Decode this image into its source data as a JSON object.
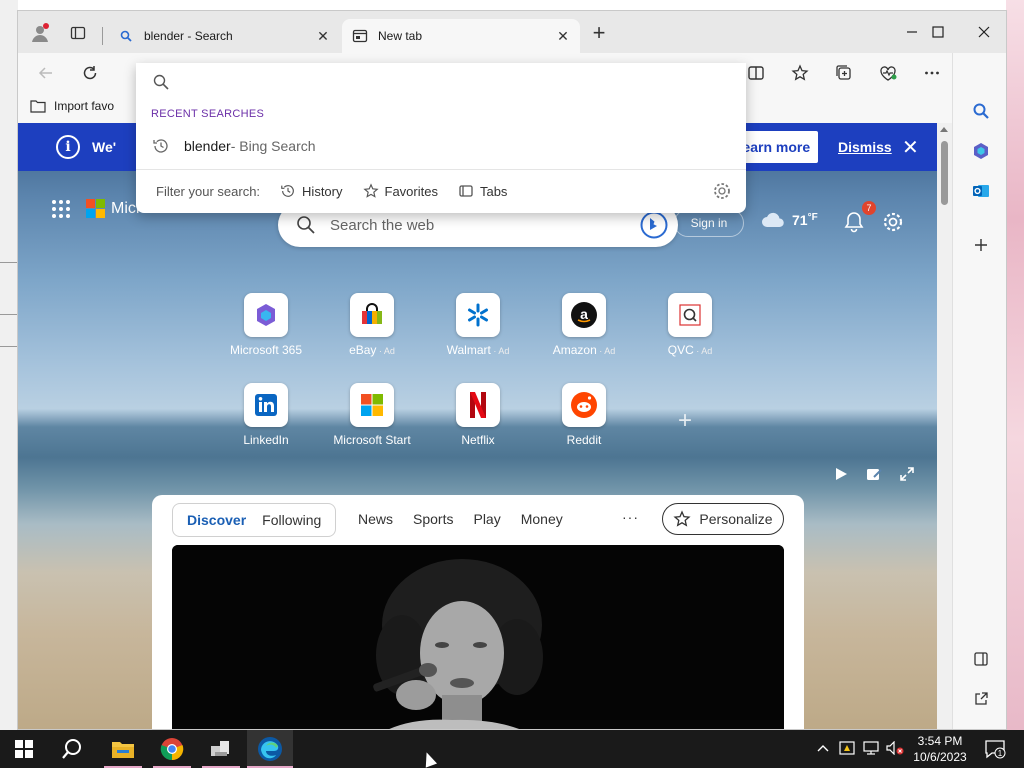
{
  "tabs": [
    {
      "title": "blender - Search",
      "active": false
    },
    {
      "title": "New tab",
      "active": true
    }
  ],
  "favorites_bar": {
    "import_label": "Import favo"
  },
  "address_dropdown": {
    "recent_header": "RECENT SEARCHES",
    "recent_items": [
      {
        "query": "blender",
        "suffix": " - Bing Search"
      }
    ],
    "filter_label": "Filter your search:",
    "filters": [
      "History",
      "Favorites",
      "Tabs"
    ]
  },
  "banner": {
    "message": "We'",
    "learn_more": "Learn more",
    "dismiss": "Dismiss"
  },
  "header": {
    "brand": "Microsoft Start",
    "search_placeholder": "Search the web",
    "sign_in": "Sign in",
    "temperature": "71",
    "temperature_unit": "°F",
    "notification_count": "7"
  },
  "quick_links": [
    {
      "name": "Microsoft 365",
      "ad": ""
    },
    {
      "name": "eBay",
      "ad": " · Ad"
    },
    {
      "name": "Walmart",
      "ad": " · Ad"
    },
    {
      "name": "Amazon",
      "ad": " · Ad"
    },
    {
      "name": "QVC",
      "ad": " · Ad"
    },
    {
      "name": "LinkedIn",
      "ad": ""
    },
    {
      "name": "Microsoft Start",
      "ad": ""
    },
    {
      "name": "Netflix",
      "ad": ""
    },
    {
      "name": "Reddit",
      "ad": ""
    }
  ],
  "feed": {
    "tabs": [
      "Discover",
      "Following"
    ],
    "active_tab": "Discover",
    "links": [
      "News",
      "Sports",
      "Play",
      "Money"
    ],
    "more": "···",
    "personalize": "Personalize"
  },
  "taskbar": {
    "time": "3:54 PM",
    "date": "10/6/2023",
    "notification_count": "1"
  },
  "colors": {
    "banner": "#1d3fbf",
    "accent": "#1a5fb4",
    "recent_header": "#6b2fa8"
  }
}
